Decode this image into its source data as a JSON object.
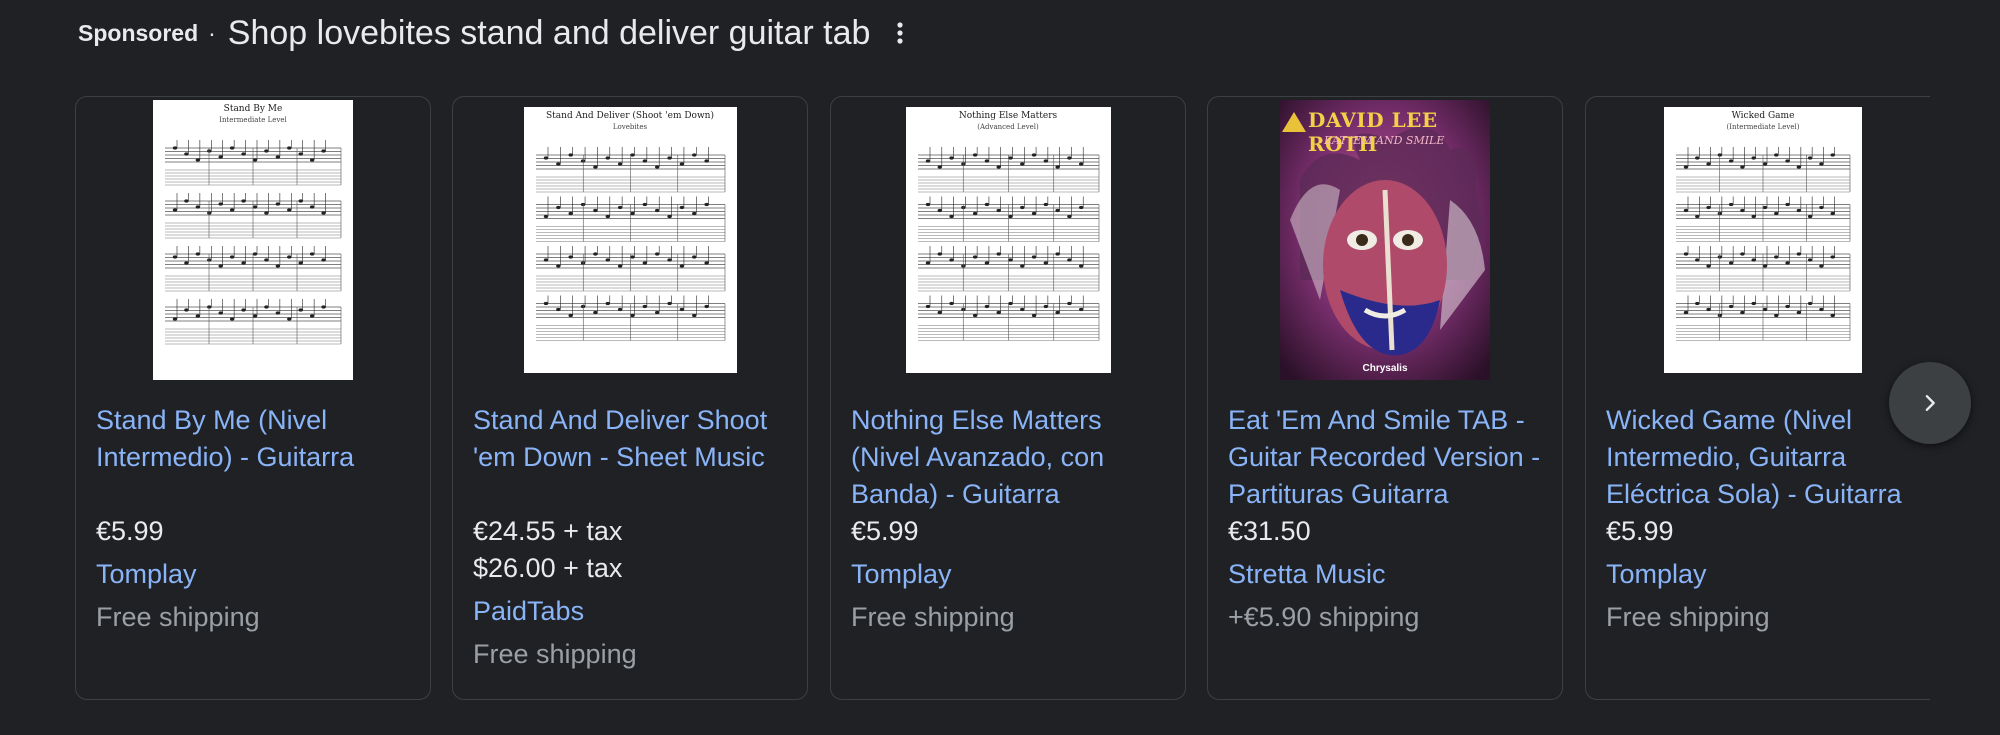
{
  "header": {
    "sponsored": "Sponsored",
    "separator": "·",
    "title": "Shop lovebites stand and deliver guitar tab",
    "more_icon": "more-vert-icon"
  },
  "products": [
    {
      "title": "Stand By Me (Nivel Intermedio) - Guitarra",
      "prices": [
        "€5.99"
      ],
      "merchant": "Tomplay",
      "shipping": "Free shipping",
      "image": {
        "kind": "sheet-music",
        "title": "Stand By Me",
        "subtitle": "Intermediate Level"
      }
    },
    {
      "title": "Stand And Deliver Shoot 'em Down - Sheet Music",
      "prices": [
        "€24.55 + tax",
        "$26.00 + tax"
      ],
      "merchant": "PaidTabs",
      "shipping": "Free shipping",
      "image": {
        "kind": "sheet-music",
        "title": "Stand And Deliver (Shoot 'em Down)",
        "subtitle": "Lovebites"
      }
    },
    {
      "title": "Nothing Else Matters (Nivel Avanzado, con Banda) - Guitarra",
      "prices": [
        "€5.99"
      ],
      "merchant": "Tomplay",
      "shipping": "Free shipping",
      "image": {
        "kind": "sheet-music",
        "title": "Nothing Else Matters",
        "subtitle": "(Advanced Level)"
      }
    },
    {
      "title": "Eat 'Em And Smile TAB - Guitar Recorded Version - Partituras Guitarra",
      "prices": [
        "€31.50"
      ],
      "merchant": "Stretta Music",
      "shipping": "+€5.90 shipping",
      "image": {
        "kind": "album-cover",
        "title": "DAVID LEE ROTH",
        "subtitle": "EAT 'EM AND SMILE",
        "footer": "Chrysalis"
      }
    },
    {
      "title": "Wicked Game (Nivel Intermedio, Guitarra Eléctrica Sola) - Guitarra",
      "prices": [
        "€5.99"
      ],
      "merchant": "Tomplay",
      "shipping": "Free shipping",
      "image": {
        "kind": "sheet-music",
        "title": "Wicked Game",
        "subtitle": "(Intermediate Level)"
      }
    }
  ],
  "next_button": {
    "icon": "chevron-right-icon"
  },
  "colors": {
    "background": "#202124",
    "link": "#8ab4f8",
    "text": "#e8eaed",
    "muted": "#9aa0a6",
    "border": "#3c4043"
  }
}
